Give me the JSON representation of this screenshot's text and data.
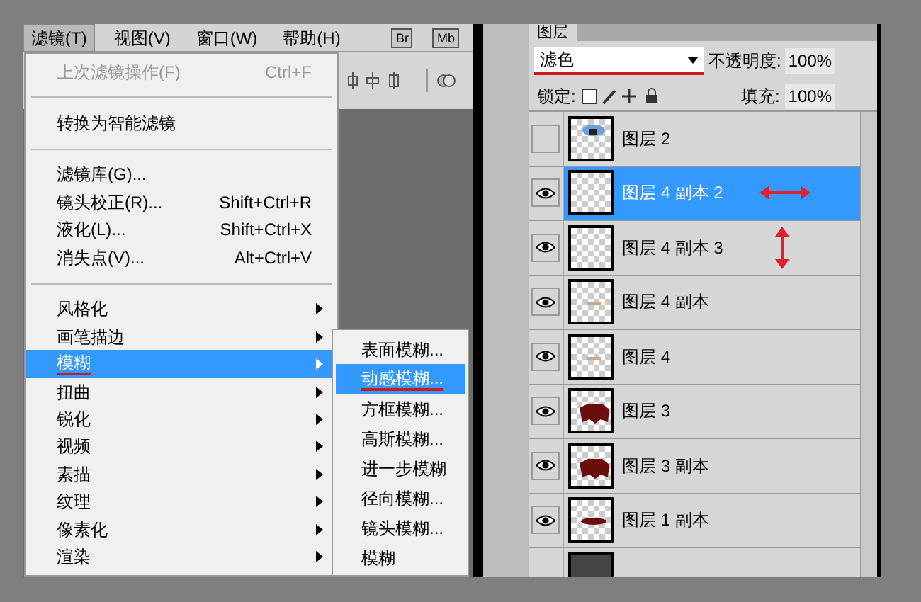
{
  "menu_bar": {
    "items": [
      {
        "label": "滤镜(T)",
        "selected": true
      },
      {
        "label": "视图(V)",
        "selected": false
      },
      {
        "label": "窗口(W)",
        "selected": false
      },
      {
        "label": "帮助(H)",
        "selected": false
      }
    ],
    "buttons": [
      "Br",
      "Mb"
    ]
  },
  "filter_menu": {
    "items": [
      {
        "kind": "item",
        "label": "上次滤镜操作(F)",
        "shortcut": "Ctrl+F",
        "disabled": true
      },
      {
        "kind": "separator"
      },
      {
        "kind": "item",
        "label": "转换为智能滤镜",
        "disabled": false
      },
      {
        "kind": "separator"
      },
      {
        "kind": "item",
        "label": "滤镜库(G)...",
        "disabled": false
      },
      {
        "kind": "item",
        "label": "镜头校正(R)...",
        "shortcut": "Shift+Ctrl+R",
        "disabled": false
      },
      {
        "kind": "item",
        "label": "液化(L)...",
        "shortcut": "Shift+Ctrl+X",
        "disabled": false
      },
      {
        "kind": "item",
        "label": "消失点(V)...",
        "shortcut": "Alt+Ctrl+V",
        "disabled": false
      },
      {
        "kind": "separator"
      },
      {
        "kind": "submenu",
        "label": "风格化",
        "selected": false,
        "underlined": false
      },
      {
        "kind": "submenu",
        "label": "画笔描边",
        "selected": false,
        "underlined": false
      },
      {
        "kind": "submenu",
        "label": "模糊",
        "selected": true,
        "underlined": true
      },
      {
        "kind": "submenu",
        "label": "扭曲",
        "selected": false,
        "underlined": false
      },
      {
        "kind": "submenu",
        "label": "锐化",
        "selected": false,
        "underlined": false
      },
      {
        "kind": "submenu",
        "label": "视频",
        "selected": false,
        "underlined": false
      },
      {
        "kind": "submenu",
        "label": "素描",
        "selected": false,
        "underlined": false
      },
      {
        "kind": "submenu",
        "label": "纹理",
        "selected": false,
        "underlined": false
      },
      {
        "kind": "submenu",
        "label": "像素化",
        "selected": false,
        "underlined": false
      },
      {
        "kind": "submenu",
        "label": "渲染",
        "selected": false,
        "underlined": false
      }
    ]
  },
  "blur_submenu": {
    "items": [
      {
        "label": "表面模糊...",
        "selected": false,
        "underlined": false
      },
      {
        "label": "动感模糊...",
        "selected": true,
        "underlined": true
      },
      {
        "label": "方框模糊...",
        "selected": false,
        "underlined": false
      },
      {
        "label": "高斯模糊...",
        "selected": false,
        "underlined": false
      },
      {
        "label": "进一步模糊",
        "selected": false,
        "underlined": false
      },
      {
        "label": "径向模糊...",
        "selected": false,
        "underlined": false
      },
      {
        "label": "镜头模糊...",
        "selected": false,
        "underlined": false
      },
      {
        "label": "模糊",
        "selected": false,
        "underlined": false
      }
    ]
  },
  "layers_panel": {
    "tab": "图层",
    "blend_mode": "滤色",
    "blend_underlined": true,
    "opacity_label": "不透明度:",
    "opacity": "100%",
    "lock_label": "锁定:",
    "fill_label": "填充:",
    "fill": "100%",
    "layers": [
      {
        "name": "图层 2",
        "visible": false,
        "selected": false,
        "thumbnail": {
          "kind": "photo"
        }
      },
      {
        "name": "图层 4 副本 2",
        "visible": true,
        "selected": true,
        "thumbnail": {
          "kind": "empty"
        },
        "annotation": {
          "kind": "horizontal"
        }
      },
      {
        "name": "图层 4 副本 3",
        "visible": true,
        "selected": false,
        "thumbnail": {
          "kind": "empty"
        },
        "annotation": {
          "kind": "vertical"
        }
      },
      {
        "name": "图层 4 副本",
        "visible": true,
        "selected": false,
        "thumbnail": {
          "kind": "dash"
        }
      },
      {
        "name": "图层 4",
        "visible": true,
        "selected": false,
        "thumbnail": {
          "kind": "dash"
        }
      },
      {
        "name": "图层 3",
        "visible": true,
        "selected": false,
        "thumbnail": {
          "kind": "blob"
        }
      },
      {
        "name": "图层 3 副本",
        "visible": true,
        "selected": false,
        "thumbnail": {
          "kind": "blob"
        }
      },
      {
        "name": "图层 1 副本",
        "visible": true,
        "selected": false,
        "thumbnail": {
          "kind": "bar"
        }
      }
    ]
  }
}
